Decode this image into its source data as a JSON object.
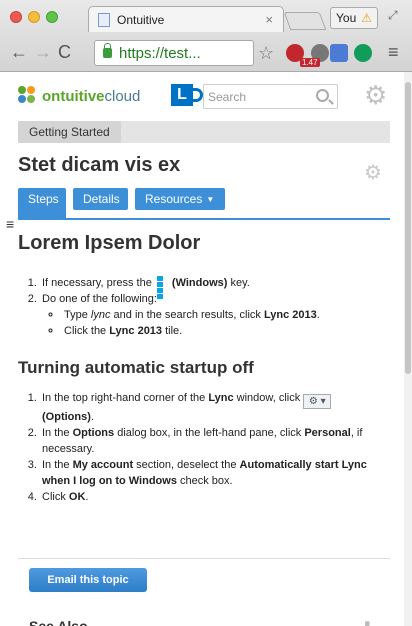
{
  "browser": {
    "tab_title": "Ontuitive",
    "tab_close": "×",
    "profile_label": "You",
    "profile_warning": "⚠",
    "url_secure": "https://test...",
    "back": "←",
    "forward": "→",
    "reload": "C",
    "star": "☆",
    "menu": "≡",
    "extension_badge": "1.47"
  },
  "header": {
    "logo_brand": "ontuitive",
    "logo_suffix": "cloud",
    "search_placeholder": "Search",
    "gear": "⚙"
  },
  "breadcrumb": {
    "item": "Getting Started"
  },
  "topic": {
    "title": "Stet dicam vis ex",
    "gear": "⚙"
  },
  "tabs": {
    "steps": "Steps",
    "details": "Details",
    "resources": "Resources",
    "caret": "▼"
  },
  "content": {
    "heading1": "Lorem Ipsem Dolor",
    "s1_step1_a": "If necessary, press the",
    "s1_step1_b": "(Windows)",
    "s1_step1_c": "key.",
    "s1_step2": "Do one of the following:",
    "s1_sub1_a": "Type",
    "s1_sub1_b": "lync",
    "s1_sub1_c": "and in the search results, click",
    "s1_sub1_d": "Lync 2013",
    "s1_sub2_a": "Click the",
    "s1_sub2_b": "Lync 2013",
    "s1_sub2_c": "tile.",
    "heading2": "Turning automatic startup off",
    "s2_step1_a": "In the top right-hand corner of the",
    "s2_step1_b": "Lync",
    "s2_step1_c": "window, click",
    "s2_step1_d": "(Options)",
    "s2_step2_a": "In the",
    "s2_step2_b": "Options",
    "s2_step2_c": "dialog box, in the left-hand pane, click",
    "s2_step2_d": "Personal",
    "s2_step2_e": ", if necessary.",
    "s2_step3_a": "In the",
    "s2_step3_b": "My account",
    "s2_step3_c": "section, deselect the",
    "s2_step3_d": "Automatically start Lync when I log on to Windows",
    "s2_step3_e": "check box.",
    "s2_step4_a": "Click",
    "s2_step4_b": "OK",
    "gear_button": "⚙ ▾"
  },
  "footer": {
    "email_button": "Email this topic",
    "see_also": "See Also"
  },
  "colors": {
    "accent_blue": "#3d8fd8",
    "brand_green": "#5aa52b"
  }
}
